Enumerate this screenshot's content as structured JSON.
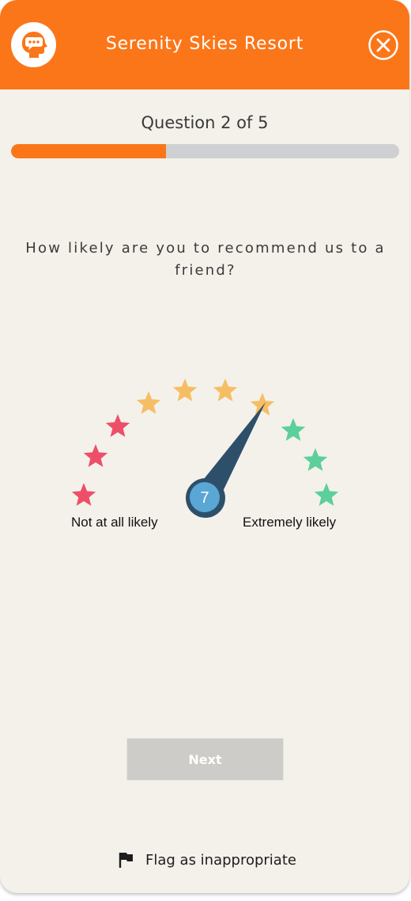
{
  "header": {
    "title": "Serenity Skies Resort",
    "logo_icon": "chat-head-icon",
    "close_icon": "close-icon"
  },
  "progress": {
    "label": "Question 2 of 5",
    "current": 2,
    "total": 5,
    "fill_fraction": 0.4
  },
  "question": {
    "text": "How likely are you to recommend us to a friend?"
  },
  "gauge": {
    "value": "7",
    "min_label": "Not at all likely",
    "max_label": "Extremely likely",
    "star_colors": [
      "#ee4f68",
      "#ee4f68",
      "#ee4f68",
      "#f6be64",
      "#f6be64",
      "#f6be64",
      "#f6be64",
      "#5ccf9a",
      "#5ccf9a",
      "#5ccf9a"
    ],
    "needle_color": "#2e4f6a",
    "hub_color": "#5aa7d6"
  },
  "actions": {
    "next_label": "Next",
    "flag_label": "Flag as inappropriate",
    "flag_icon": "flag-icon"
  },
  "colors": {
    "accent": "#fb7619",
    "background": "#f4f1eb",
    "track": "#cfd0d2",
    "button_disabled": "#cdccc8"
  }
}
